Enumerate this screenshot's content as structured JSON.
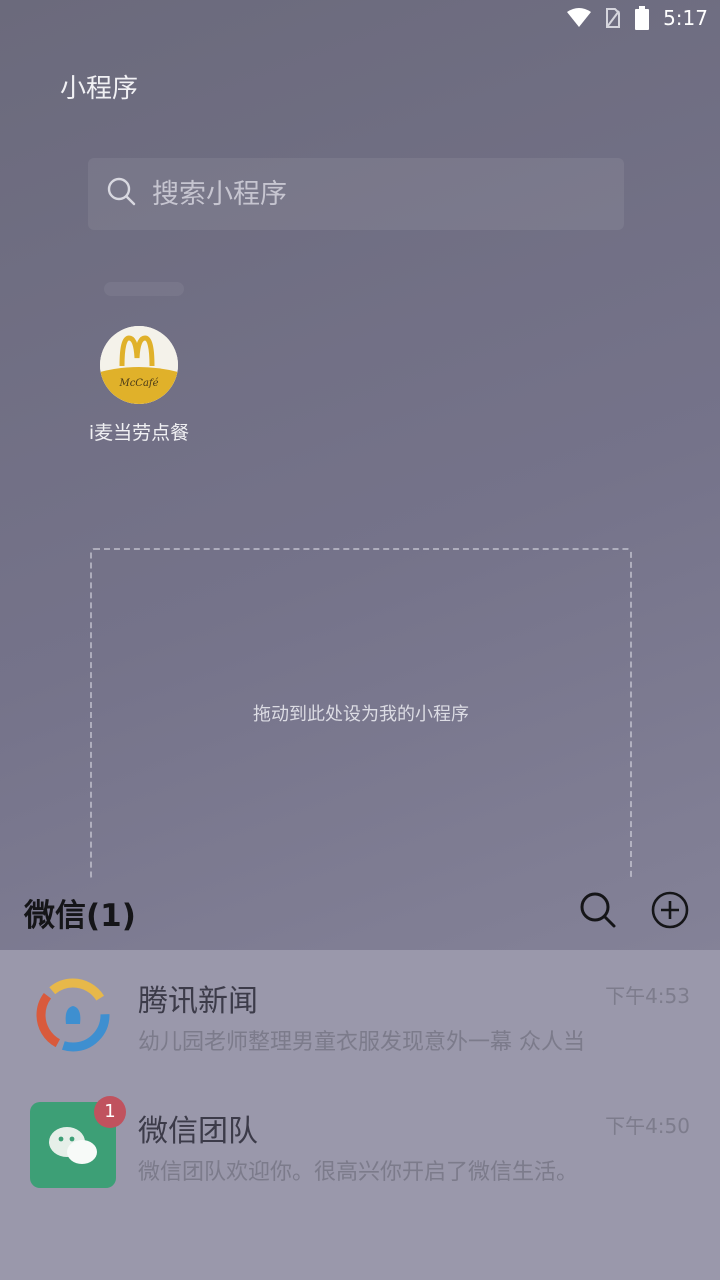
{
  "status_bar": {
    "time": "5:17"
  },
  "miniprogram": {
    "title": "小程序",
    "search_placeholder": "搜索小程序",
    "apps": [
      {
        "name": "i麦当劳点餐",
        "icon": "mcdonalds-mccafe-icon",
        "icon_text": "McCafé"
      }
    ],
    "drop_hint": "拖动到此处设为我的小程序"
  },
  "wechat": {
    "title": "微信(1)",
    "chats": [
      {
        "name": "腾讯新闻",
        "preview": "幼儿园老师整理男童衣服发现意外一幕 众人当",
        "time": "下午4:53",
        "avatar": "tencent-news-icon"
      },
      {
        "name": "微信团队",
        "preview": "微信团队欢迎你。很高兴你开启了微信生活。",
        "time": "下午4:50",
        "avatar": "wechat-team-icon",
        "badge": "1"
      }
    ]
  },
  "colors": {
    "wechat_green": "#3d9f76",
    "badge_red": "#c0525e",
    "mc_yellow": "#e0b12a"
  }
}
